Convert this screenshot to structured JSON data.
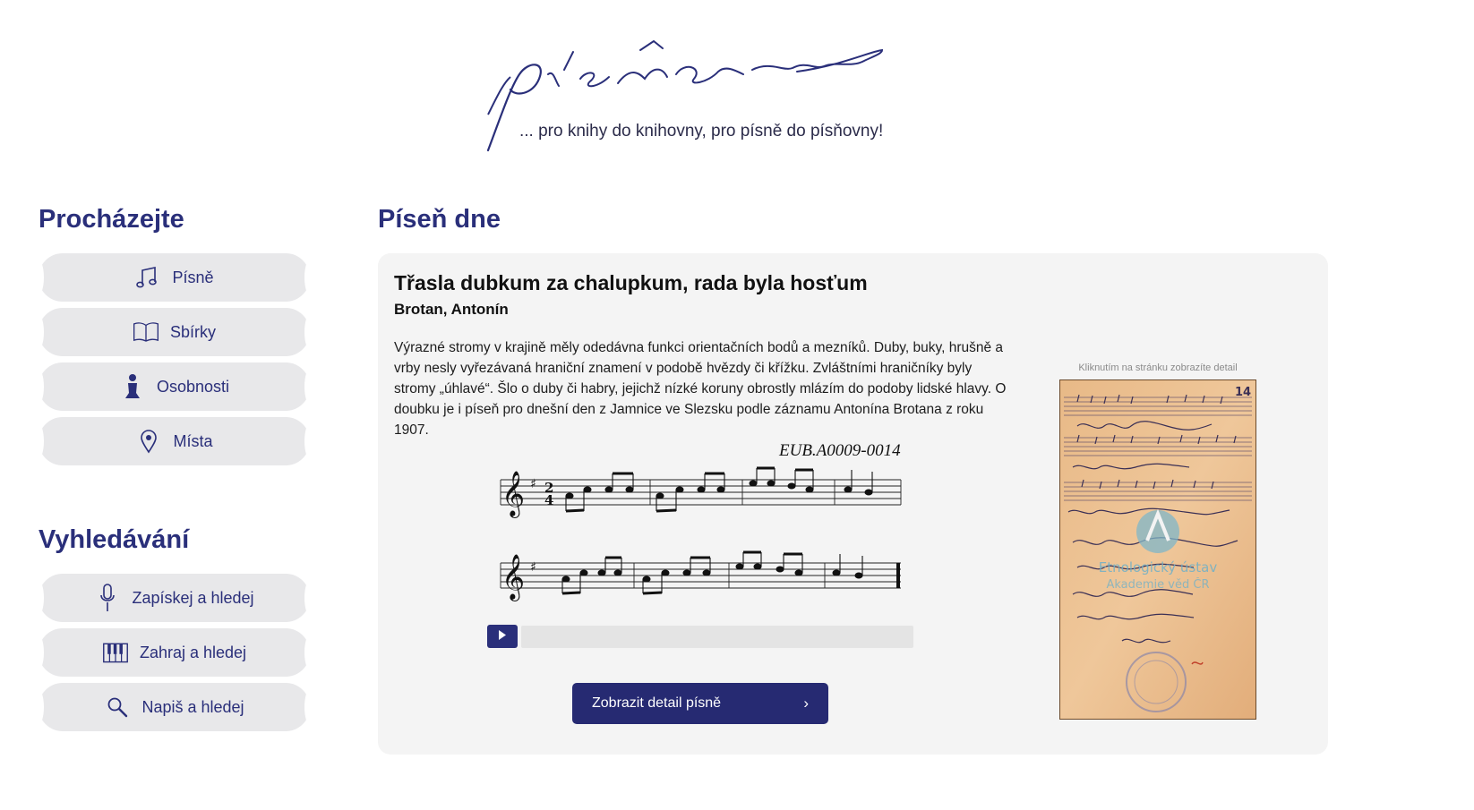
{
  "header": {
    "logo_text": "písňorna",
    "tagline": "... pro knihy do knihovny, pro písně do písňovny!"
  },
  "browse": {
    "heading": "Procházejte",
    "items": [
      {
        "label": "Písně",
        "icon": "music-note-icon"
      },
      {
        "label": "Sbírky",
        "icon": "open-book-icon"
      },
      {
        "label": "Osobnosti",
        "icon": "person-icon"
      },
      {
        "label": "Místa",
        "icon": "location-pin-icon"
      }
    ]
  },
  "search": {
    "heading": "Vyhledávání",
    "items": [
      {
        "label": "Zapískej a hledej",
        "icon": "microphone-icon"
      },
      {
        "label": "Zahraj a hledej",
        "icon": "piano-keys-icon"
      },
      {
        "label": "Napiš a hledej",
        "icon": "magnifier-icon"
      }
    ]
  },
  "song_of_day": {
    "heading": "Píseň dne",
    "title": "Třasla dubkum za chalupkum, rada byla hosťum",
    "author": "Brotan, Antonín",
    "description": "Výrazné stromy v krajině měly odedávna funkci orientačních bodů a mezníků. Duby, buky, hrušně a vrby nesly vyřezávaná hraniční znamení v podobě hvězdy či křížku. Zvláštními hraničníky byly stromy „úhlavé“. Šlo o duby či habry, jejichž nízké koruny obrostly mlázím do podoby lidské hlavy. O doubku je i píseň pro dnešní den z Jamnice ve Slezsku podle záznamu Antonína Brotana z roku 1907.",
    "score_id": "EUB.A0009-0014",
    "detail_button": "Zobrazit detail písně",
    "image_hint": "Kliknutím na stránku zobrazíte detail",
    "manuscript_watermark_line1": "Etnologický ústav",
    "manuscript_watermark_line2": "Akademie věd ČR"
  },
  "colors": {
    "brand": "#2a2f7a",
    "button_bg": "#e8e8ea",
    "card_bg": "#f4f4f4",
    "primary_button": "#262a72"
  }
}
